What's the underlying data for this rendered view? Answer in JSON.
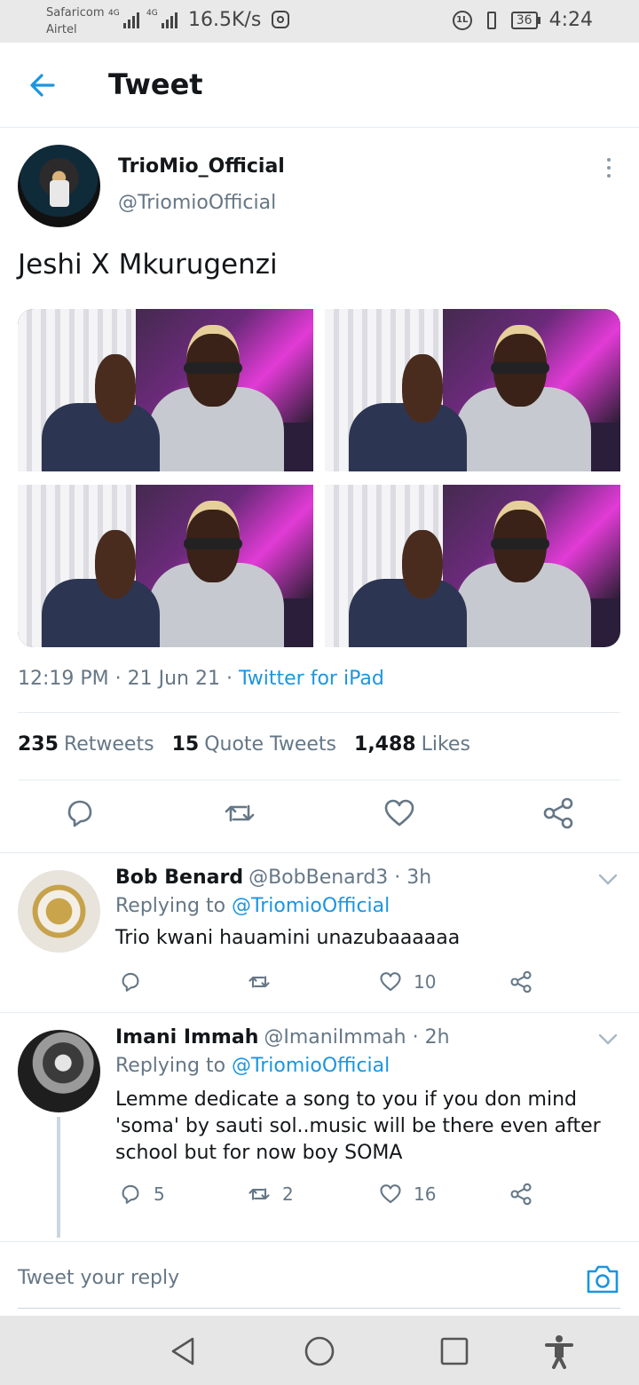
{
  "status_bar": {
    "carrier_1": "Safaricom",
    "carrier_2": "Airtel",
    "network_1": "4G",
    "network_2": "4G",
    "speed": "16.5K/s",
    "battery": "36",
    "time": "4:24"
  },
  "header": {
    "title": "Tweet",
    "back_icon": "arrow-left-icon"
  },
  "tweet": {
    "author_name": "TrioMio_Official",
    "author_handle": "@TriomioOfficial",
    "text": "Jeshi X Mkurugenzi",
    "time": "12:19 PM",
    "date": "21 Jun 21",
    "separator": " · ",
    "source": "Twitter for iPad",
    "photos_count": 4,
    "stats": {
      "retweets_count": "235",
      "retweets_label": "Retweets",
      "quotes_count": "15",
      "quotes_label": "Quote Tweets",
      "likes_count": "1,488",
      "likes_label": "Likes"
    }
  },
  "replies": [
    {
      "name": "Bob Benard",
      "handle": "@BobBenard3",
      "age": " · 3h",
      "replying_prefix": "Replying to ",
      "replying_to": "@TriomioOfficial",
      "text": "Trio kwani hauamini unazubaaaaaa",
      "reply_count": "",
      "retweet_count": "",
      "like_count": "10"
    },
    {
      "name": "Imani Immah",
      "handle": "@ImaniImmah",
      "age": " · 2h",
      "replying_prefix": "Replying to ",
      "replying_to": "@TriomioOfficial",
      "text": "Lemme dedicate a song to you if you don mind 'soma' by sauti sol..music will be there even after school but for now boy SOMA",
      "reply_count": "5",
      "retweet_count": "2",
      "like_count": "16"
    }
  ],
  "composer": {
    "placeholder": "Tweet your reply"
  },
  "colors": {
    "accent": "#1b95e0",
    "text_primary": "#14171a",
    "text_secondary": "#657786",
    "divider": "#e6ecf0"
  }
}
